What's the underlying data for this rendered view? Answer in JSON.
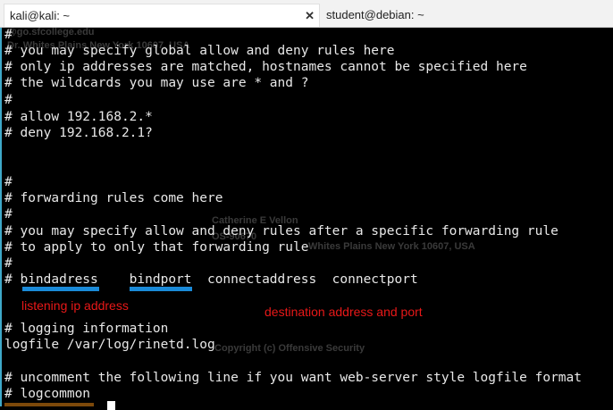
{
  "tabs": [
    {
      "title": "kali@kali: ~",
      "active": true
    },
    {
      "title": "student@debian: ~",
      "active": false
    }
  ],
  "terminal_lines": [
    "#",
    "# you may specify global allow and deny rules here",
    "# only ip addresses are matched, hostnames cannot be specified here",
    "# the wildcards you may use are * and ?",
    "#",
    "# allow 192.168.2.*",
    "# deny 192.168.2.1?",
    "",
    "",
    "#",
    "# forwarding rules come here",
    "#",
    "# you may specify allow and deny rules after a specific forwarding rule",
    "# to apply to only that forwarding rule",
    "#",
    "# bindadress    bindport  connectaddress  connectport",
    "",
    "",
    "# logging information",
    "logfile /var/log/rinetd.log",
    "",
    "# uncomment the following line if you want web-server style logfile format",
    "# logcommon"
  ],
  "annotations": {
    "listening": "listening ip address",
    "destination": "destination address and port",
    "underline_color": "#1a8ad8",
    "text_color": "#e81818"
  },
  "watermark": {
    "email": "@go.sfcollege.edu",
    "address": "Dr. Whites Plains New York 10607, USA",
    "name": "Catherine E Vellon",
    "id": "OS-90670",
    "address2": "Whites Plains New York 10607, USA",
    "copyright": "Copyright (c) Offensive Security"
  }
}
